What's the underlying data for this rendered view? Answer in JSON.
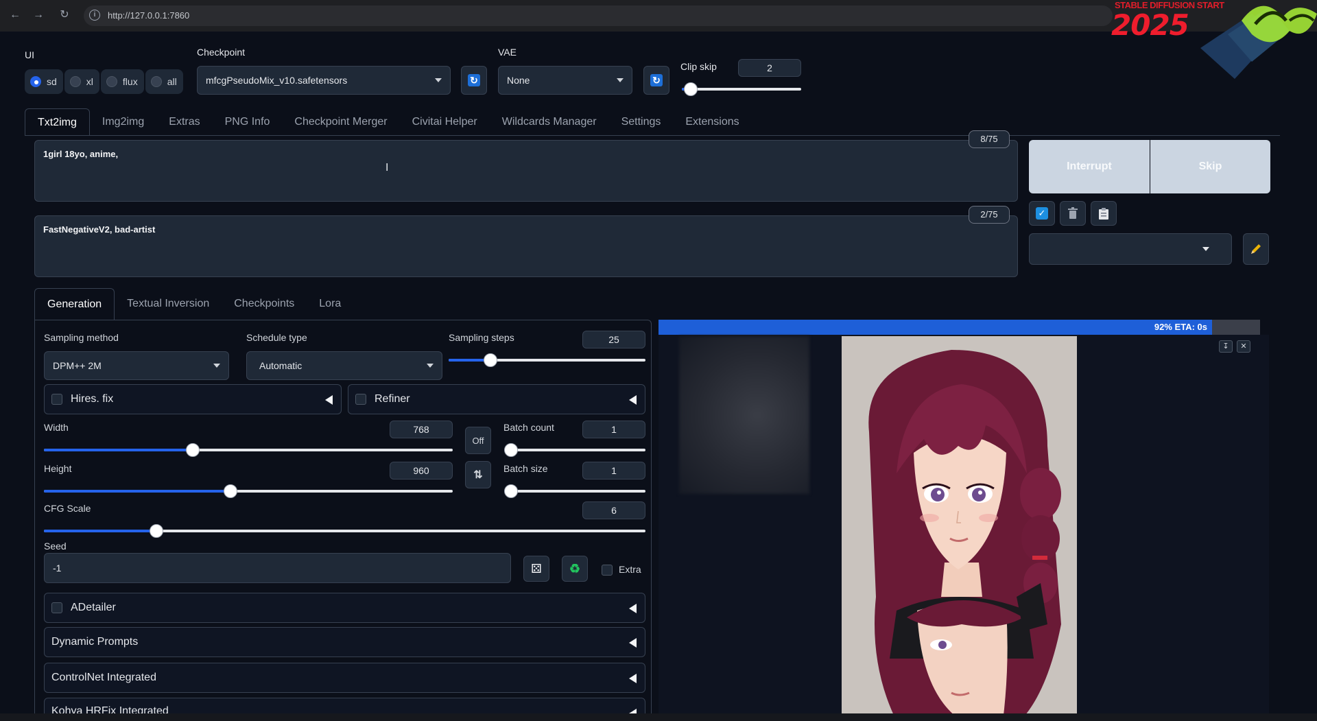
{
  "browser": {
    "back_icon": "arrow-left-icon",
    "forward_icon": "arrow-right-icon",
    "reload_icon": "reload-icon",
    "url": "http://127.0.0.1:7860"
  },
  "promo": {
    "top_text": "STABLE DIFFUSION START",
    "year": "2025"
  },
  "ui": {
    "label": "UI",
    "options": [
      {
        "label": "sd",
        "selected": true
      },
      {
        "label": "xl",
        "selected": false
      },
      {
        "label": "flux",
        "selected": false
      },
      {
        "label": "all",
        "selected": false
      }
    ]
  },
  "checkpoint": {
    "label": "Checkpoint",
    "value": "mfcgPseudoMix_v10.safetensors"
  },
  "vae": {
    "label": "VAE",
    "value": "None"
  },
  "clip_skip": {
    "label": "Clip skip",
    "value": "2",
    "fraction": 0.02
  },
  "main_tabs": [
    "Txt2img",
    "Img2img",
    "Extras",
    "PNG Info",
    "Checkpoint Merger",
    "Civitai Helper",
    "Wildcards Manager",
    "Settings",
    "Extensions"
  ],
  "prompt": {
    "text": "1girl 18yo, anime,",
    "tokens": "8/75"
  },
  "negative_prompt": {
    "text": "FastNegativeV2, bad-artist",
    "tokens": "2/75"
  },
  "actions": {
    "interrupt": "Interrupt",
    "skip": "Skip"
  },
  "gen_tabs": [
    "Generation",
    "Textual Inversion",
    "Checkpoints",
    "Lora"
  ],
  "sampling_method": {
    "label": "Sampling method",
    "value": "DPM++ 2M"
  },
  "schedule_type": {
    "label": "Schedule type",
    "value": "Automatic"
  },
  "sampling_steps": {
    "label": "Sampling steps",
    "value": "25",
    "fraction": 0.19
  },
  "hires_fix": {
    "label": "Hires. fix"
  },
  "refiner": {
    "label": "Refiner"
  },
  "width": {
    "label": "Width",
    "value": "768",
    "fraction": 0.36
  },
  "height": {
    "label": "Height",
    "value": "960",
    "fraction": 0.455
  },
  "toggle_off": "Off",
  "batch_count": {
    "label": "Batch count",
    "value": "1",
    "fraction": 0.0
  },
  "batch_size": {
    "label": "Batch size",
    "value": "1",
    "fraction": 0.0
  },
  "cfg_scale": {
    "label": "CFG Scale",
    "value": "6",
    "fraction": 0.18
  },
  "seed": {
    "label": "Seed",
    "value": "-1",
    "extra_label": "Extra"
  },
  "accordions": [
    "ADetailer",
    "Dynamic Prompts",
    "ControlNet Integrated",
    "Kohya HRFix Integrated"
  ],
  "progress": {
    "text": "92% ETA: 0s",
    "fraction": 0.92
  }
}
